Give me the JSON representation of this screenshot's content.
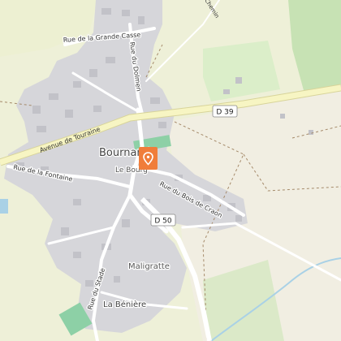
{
  "map": {
    "place_name": "Bournand",
    "locality": "Le Bourg",
    "hamlets": [
      "Maligratte",
      "La Bénière"
    ],
    "streets": {
      "grande_casse": "Rue de la Grande Casse",
      "dolmen": "Rue du Dolmen",
      "touraine": "Avenue de Touraine",
      "fontaine": "Rue de la Fontaine",
      "bois_craon": "Rue du Bois de Craon",
      "stade": "Rue du Stade",
      "chemin": "Chemin"
    },
    "road_shields": [
      "D 39",
      "D 50"
    ],
    "marker": {
      "icon": "location-pin-icon",
      "color": "#f07d3a"
    },
    "colors": {
      "land": "#eef0d8",
      "urban": "#d6d6da",
      "building": "#c2c2c8",
      "forest": "#c7e2b4",
      "field": "#f1eee2",
      "primary_road": "#f7f5c3",
      "water": "#a9d1e6",
      "pitch": "#8dd0a6"
    }
  }
}
